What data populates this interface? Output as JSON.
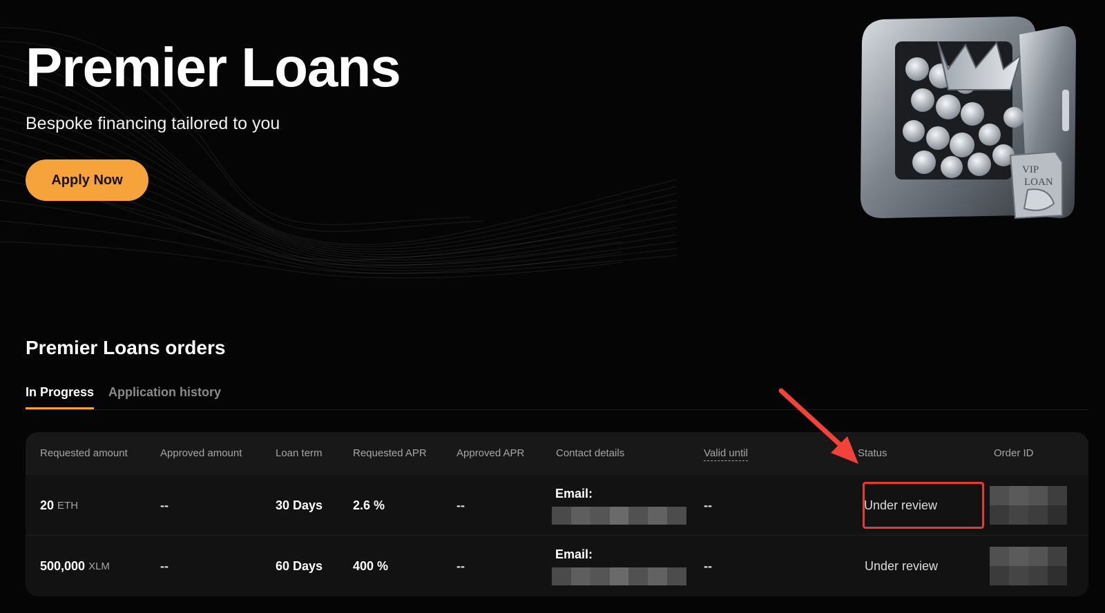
{
  "hero": {
    "title": "Premier Loans",
    "subtitle": "Bespoke financing tailored to you",
    "apply_label": "Apply Now",
    "image_text": [
      "VIP",
      "LOAN"
    ]
  },
  "orders": {
    "title": "Premier Loans orders",
    "tabs": [
      {
        "label": "In Progress",
        "active": true
      },
      {
        "label": "Application history",
        "active": false
      }
    ],
    "columns": [
      "Requested amount",
      "Approved amount",
      "Loan term",
      "Requested APR",
      "Approved APR",
      "Contact details",
      "Valid until",
      "Status",
      "Order ID"
    ],
    "rows": [
      {
        "amount": "20",
        "unit": "ETH",
        "approved": "--",
        "term": "30 Days",
        "apr": "2.6 %",
        "approved_apr": "--",
        "contact_label": "Email:",
        "valid_until": "--",
        "status": "Under review",
        "highlighted": true
      },
      {
        "amount": "500,000",
        "unit": "XLM",
        "approved": "--",
        "term": "60 Days",
        "apr": "400 %",
        "approved_apr": "--",
        "contact_label": "Email:",
        "valid_until": "--",
        "status": "Under review",
        "highlighted": false
      }
    ]
  },
  "colors": {
    "accent": "#f7a33c",
    "highlight": "#e53935",
    "background": "#050505"
  }
}
